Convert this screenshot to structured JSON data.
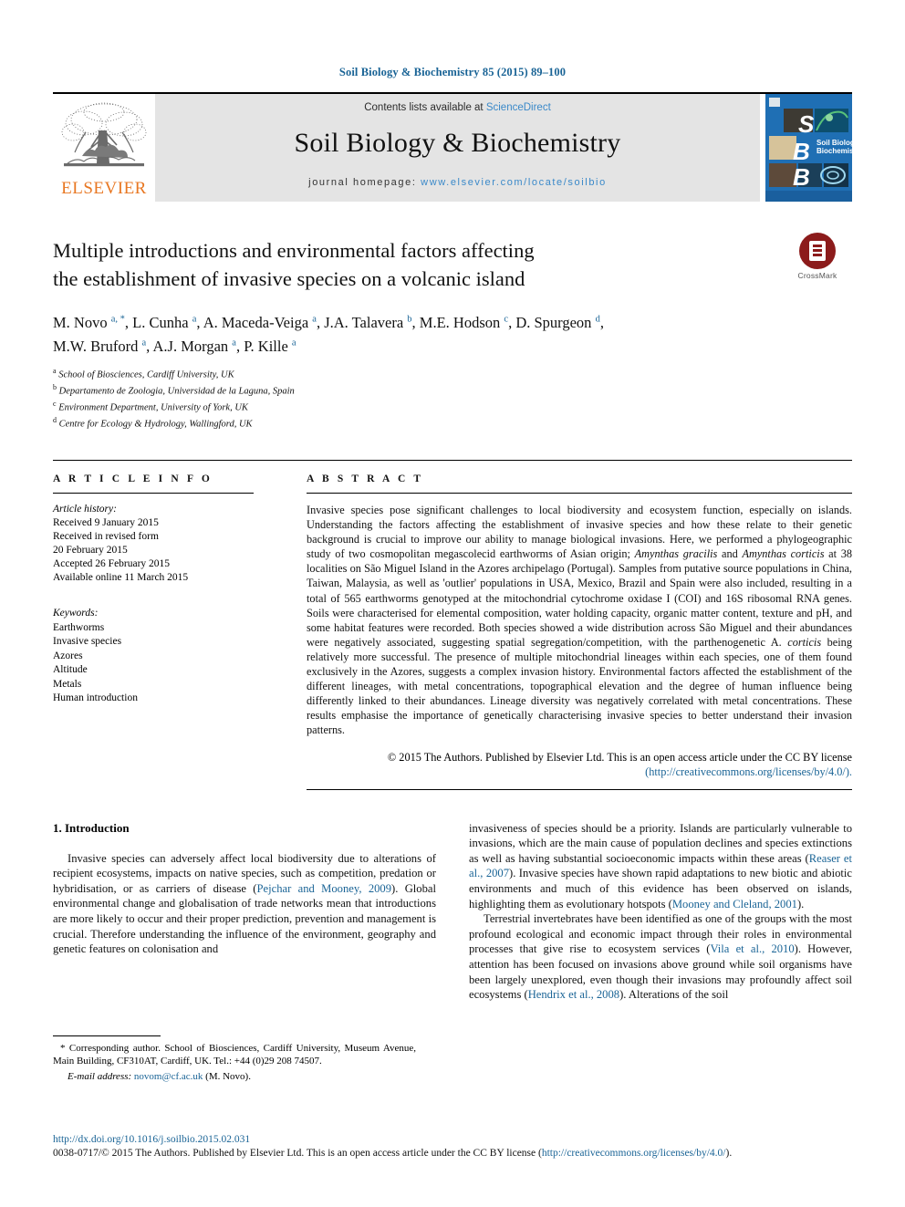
{
  "running_head": "Soil Biology & Biochemistry 85 (2015) 89–100",
  "masthead": {
    "publisher": "ELSEVIER",
    "contents_prefix": "Contents lists available at ",
    "contents_link": "ScienceDirect",
    "journal_title": "Soil Biology & Biochemistry",
    "homepage_prefix": "journal homepage: ",
    "homepage_url": "www.elsevier.com/locate/soilbio",
    "cover_title_line1": "Soil Biology &",
    "cover_title_line2": "Biochemistry",
    "cover_letters": [
      "S",
      "B",
      "B"
    ],
    "accent_blue": "#1a6496",
    "cover_blue": "#1f6fb4",
    "elsevier_orange": "#E87722"
  },
  "title": {
    "line1": "Multiple introductions and environmental factors affecting",
    "line2": "the establishment of invasive species on a volcanic island",
    "crossmark_label": "CrossMark"
  },
  "authors": {
    "line1": [
      {
        "name": "M. Novo",
        "sup": "a, *"
      },
      {
        "name": "L. Cunha",
        "sup": "a"
      },
      {
        "name": "A. Maceda-Veiga",
        "sup": "a"
      },
      {
        "name": "J.A. Talavera",
        "sup": "b"
      },
      {
        "name": "M.E. Hodson",
        "sup": "c"
      },
      {
        "name": "D. Spurgeon",
        "sup": "d"
      }
    ],
    "line2": [
      {
        "name": "M.W. Bruford",
        "sup": "a"
      },
      {
        "name": "A.J. Morgan",
        "sup": "a"
      },
      {
        "name": "P. Kille",
        "sup": "a"
      }
    ]
  },
  "affiliations": [
    {
      "mark": "a",
      "text": "School of Biosciences, Cardiff University, UK"
    },
    {
      "mark": "b",
      "text": "Departamento de Zoologia, Universidad de la Laguna, Spain"
    },
    {
      "mark": "c",
      "text": "Environment Department, University of York, UK"
    },
    {
      "mark": "d",
      "text": "Centre for Ecology & Hydrology, Wallingford, UK"
    }
  ],
  "article_info": {
    "heading": "A R T I C L E   I N F O",
    "history_label": "Article history:",
    "history": [
      "Received 9 January 2015",
      "Received in revised form",
      "20 February 2015",
      "Accepted 26 February 2015",
      "Available online 11 March 2015"
    ],
    "keywords_label": "Keywords:",
    "keywords": [
      "Earthworms",
      "Invasive species",
      "Azores",
      "Altitude",
      "Metals",
      "Human introduction"
    ]
  },
  "abstract": {
    "heading": "A B S T R A C T",
    "part1": "Invasive species pose significant challenges to local biodiversity and ecosystem function, especially on islands. Understanding the factors affecting the establishment of invasive species and how these relate to their genetic background is crucial to improve our ability to manage biological invasions. Here, we performed a phylogeographic study of two cosmopolitan megascolecid earthworms of Asian origin; ",
    "italic1": "Amynthas gracilis",
    "mid1": " and ",
    "italic2": "Amynthas corticis",
    "part2": " at 38 localities on São Miguel Island in the Azores archipelago (Portugal). Samples from putative source populations in China, Taiwan, Malaysia, as well as 'outlier' populations in USA, Mexico, Brazil and Spain were also included, resulting in a total of 565 earthworms genotyped at the mitochondrial cytochrome oxidase I (COI) and 16S ribosomal RNA genes. Soils were characterised for elemental composition, water holding capacity, organic matter content, texture and pH, and some habitat features were recorded. Both species showed a wide distribution across São Miguel and their abundances were negatively associated, suggesting spatial segregation/competition, with the parthenogenetic A. ",
    "italic3": "corticis",
    "part3": " being relatively more successful. The presence of multiple mitochondrial lineages within each species, one of them found exclusively in the Azores, suggests a complex invasion history. Environmental factors affected the establishment of the different lineages, with metal concentrations, topographical elevation and the degree of human influence being differently linked to their abundances. Lineage diversity was negatively correlated with metal concentrations. These results emphasise the importance of genetically characterising invasive species to better understand their invasion patterns.",
    "copyright_text": "© 2015 The Authors. Published by Elsevier Ltd. This is an open access article under the CC BY license",
    "copyright_link": "(http://creativecommons.org/licenses/by/4.0/)."
  },
  "introduction": {
    "heading": "1. Introduction",
    "left_p1_a": "Invasive species can adversely affect local biodiversity due to alterations of recipient ecosystems, impacts on native species, such as competition, predation or hybridisation, or as carriers of disease (",
    "left_p1_ref": "Pejchar and Mooney, 2009",
    "left_p1_b": "). Global environmental change and globalisation of trade networks mean that introductions are more likely to occur and their proper prediction, prevention and management is crucial. Therefore understanding the influence of the environment, geography and genetic features on colonisation and",
    "right_p1_a": "invasiveness of species should be a priority. Islands are particularly vulnerable to invasions, which are the main cause of population declines and species extinctions as well as having substantial socioeconomic impacts within these areas (",
    "right_p1_ref1": "Reaser et al., 2007",
    "right_p1_b": "). Invasive species have shown rapid adaptations to new biotic and abiotic environments and much of this evidence has been observed on islands, highlighting them as evolutionary hotspots (",
    "right_p1_ref2": "Mooney and Cleland, 2001",
    "right_p1_c": ").",
    "right_p2_a": "Terrestrial invertebrates have been identified as one of the groups with the most profound ecological and economic impact through their roles in environmental processes that give rise to ecosystem services (",
    "right_p2_ref1": "Vila et al., 2010",
    "right_p2_b": "). However, attention has been focused on invasions above ground while soil organisms have been largely unexplored, even though their invasions may profoundly affect soil ecosystems (",
    "right_p2_ref2": "Hendrix et al., 2008",
    "right_p2_c": "). Alterations of the soil"
  },
  "footnote": {
    "corresponding": "* Corresponding author. School of Biosciences, Cardiff University, Museum Avenue, Main Building, CF310AT, Cardiff, UK. Tel.: +44 (0)29 208 74507.",
    "email_label": "E-mail address:",
    "email": "novom@cf.ac.uk",
    "email_suffix": "(M. Novo)."
  },
  "footer": {
    "doi": "http://dx.doi.org/10.1016/j.soilbio.2015.02.031",
    "issn_line_a": "0038-0717/© 2015 The Authors. Published by Elsevier Ltd. This is an open access article under the CC BY license (",
    "issn_link": "http://creativecommons.org/licenses/by/4.0/",
    "issn_line_b": ")."
  }
}
